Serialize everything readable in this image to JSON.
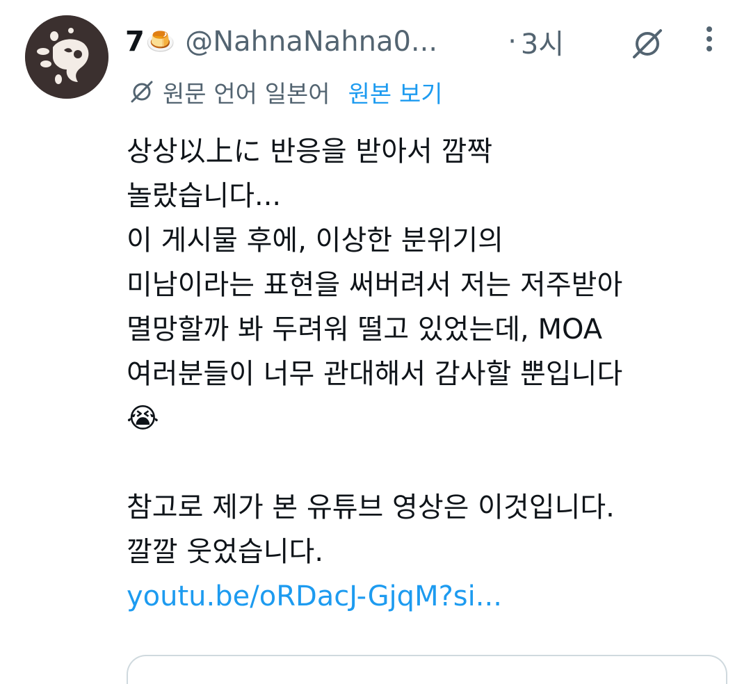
{
  "tweet": {
    "display_name": "7",
    "name_emoji": "🍮",
    "handle": "@NahnaNahna0...",
    "dot": "·",
    "time": "3시",
    "icons": {
      "avatar": "avatar-image",
      "translate": "translate-icon",
      "more": "more-vertical-icon"
    },
    "translation": {
      "source_language": "원문 언어 일본어",
      "show_original": "원본 보기"
    },
    "body_lines": [
      "상상以上に 반응을 받아서 깜짝",
      "놀랐습니다...",
      "이 게시물 후에, 이상한 분위기의",
      "미남이라는 표현을 써버려서 저는 저주받아",
      "멸망할까 봐 두려워 떨고 있었는데, MOA",
      "여러분들이 너무 관대해서 감사할 뿐입니다"
    ],
    "emoji": "😭",
    "body_lines_2": [
      "참고로 제가 본 유튜브 영상은 이것입니다.",
      "깔깔 웃었습니다."
    ],
    "link": "youtu.be/oRDacJ-GjqM?si..."
  },
  "colors": {
    "text_primary": "#0f1419",
    "text_secondary": "#536471",
    "link": "#1d9bf0",
    "avatar_bg": "#3b302f",
    "border": "#cfd9de"
  }
}
